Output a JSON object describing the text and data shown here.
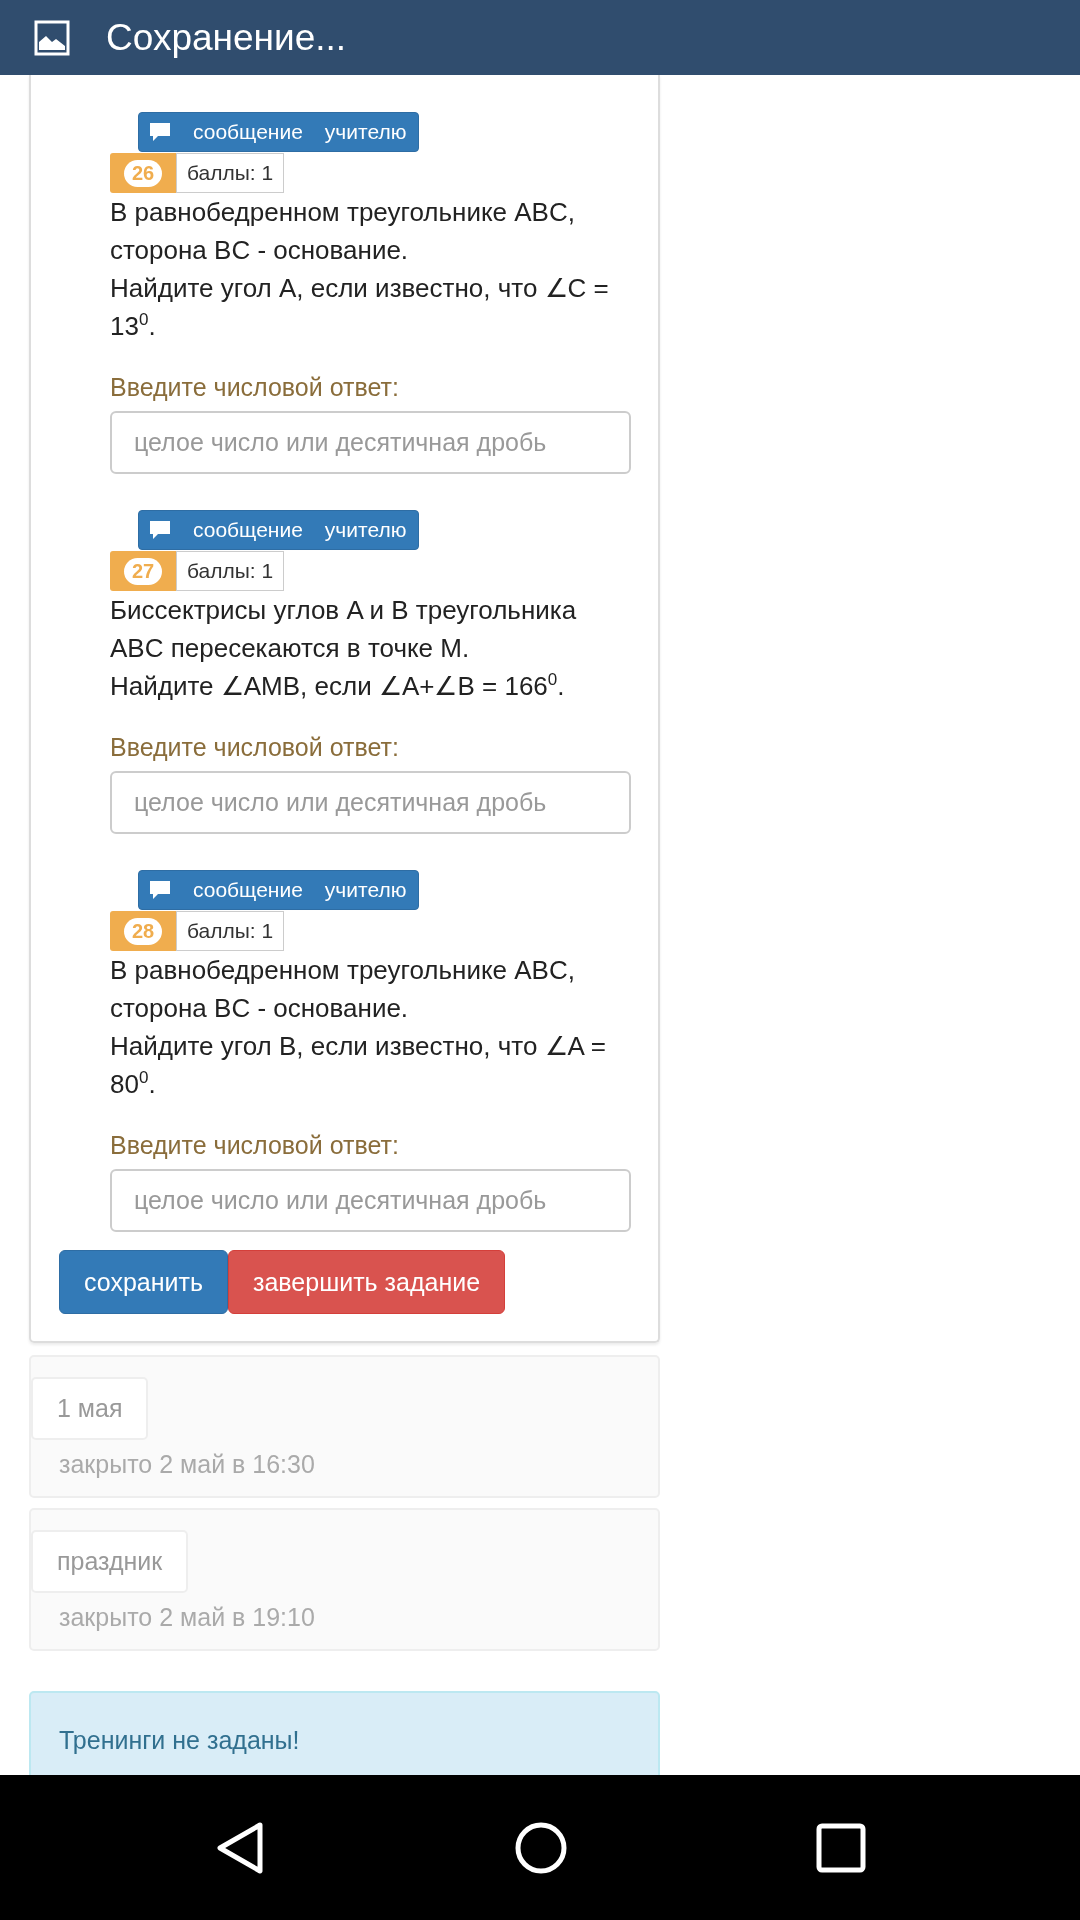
{
  "header": {
    "title": "Сохранение..."
  },
  "questions": [
    {
      "message_button": {
        "words": [
          "сообщение",
          "учителю"
        ]
      },
      "number": "26",
      "points": "баллы: 1",
      "lines": [
        "В равнобедренном треугольнике ABC, сторона BC - основание.",
        "Найдите угол A, если известно, что ∠C = 13$^{0}$."
      ],
      "answer_label": "Введите числовой ответ:",
      "placeholder": "целое число или десятичная дробь"
    },
    {
      "message_button": {
        "words": [
          "сообщение",
          "учителю"
        ]
      },
      "number": "27",
      "points": "баллы: 1",
      "lines": [
        "Биссектрисы углов A и B треугольника ABC пересекаются в точке M.",
        "Найдите ∠AMB, если ∠A+∠B = 166$^{0}$."
      ],
      "answer_label": "Введите числовой ответ:",
      "placeholder": "целое число или десятичная дробь"
    },
    {
      "message_button": {
        "words": [
          "сообщение",
          "учителю"
        ]
      },
      "number": "28",
      "points": "баллы: 1",
      "lines": [
        "В равнобедренном треугольнике ABC, сторона BC - основание.",
        "Найдите угол B, если известно, что ∠A = 80$^{0}$."
      ],
      "answer_label": "Введите числовой ответ:",
      "placeholder": "целое число или десятичная дробь"
    }
  ],
  "actions": [
    {
      "kind": "primary",
      "label": "сохранить"
    },
    {
      "kind": "danger",
      "label": "завершить задание"
    }
  ],
  "closed_tasks": [
    {
      "tag": "1 мая",
      "status": "закрыто 2 май в 16:30"
    },
    {
      "tag": "праздник",
      "status": "закрыто 2 май в 19:10"
    }
  ],
  "alert": {
    "text": "Тренинги не заданы!"
  }
}
